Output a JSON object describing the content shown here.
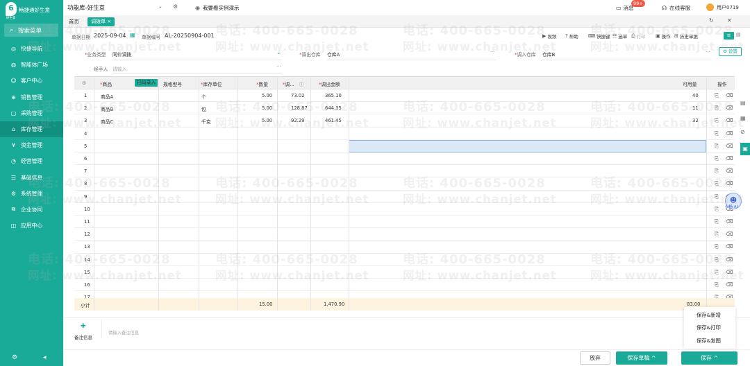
{
  "sidebar": {
    "logo_text": "畅捷通好生意",
    "logo_sub": "好生意",
    "search_label": "搜索菜单",
    "items": [
      {
        "label": "快捷导航",
        "icon": "compass-icon"
      },
      {
        "label": "智能体广场",
        "icon": "robot-icon"
      },
      {
        "label": "客户中心",
        "icon": "user-icon"
      },
      {
        "label": "销售管理",
        "icon": "cart-icon"
      },
      {
        "label": "采购管理",
        "icon": "bag-icon"
      },
      {
        "label": "库存管理",
        "icon": "warehouse-icon"
      },
      {
        "label": "资金管理",
        "icon": "money-icon"
      },
      {
        "label": "经营管理",
        "icon": "chart-icon"
      },
      {
        "label": "基础信息",
        "icon": "database-icon"
      },
      {
        "label": "系统管理",
        "icon": "gear-icon"
      },
      {
        "label": "企业协同",
        "icon": "link-icon"
      },
      {
        "label": "应用中心",
        "icon": "apps-icon"
      }
    ],
    "active": 5
  },
  "topbar": {
    "app_title": "功能库-好生意",
    "demo_link": "我要看实例演示",
    "messages": "消息",
    "badge": "99+",
    "service": "在线客服",
    "user": "用户0719"
  },
  "tabs": {
    "home": "首页",
    "active": "调拨单 ×"
  },
  "form": {
    "date_label": "单据日期",
    "date_value": "2025-09-04",
    "number_label": "单据编号",
    "number_value": "AL-20250904-001",
    "toolbar": [
      "视频",
      "帮助",
      "快捷键",
      "选单",
      "打印",
      "操作",
      "历史单据"
    ]
  },
  "fields": {
    "biz_type_label": "业务类型",
    "biz_type_value": "同价调拨",
    "out_wh_label": "调出仓库",
    "out_wh_value": "仓库A",
    "in_wh_label": "调入仓库",
    "in_wh_value": "仓库B",
    "handler_label": "经手人",
    "handler_placeholder": "请输入",
    "settings": "设置"
  },
  "table": {
    "headers": {
      "product": "商品",
      "scan": "扫码录入",
      "spec": "规格型号",
      "unit": "库存单位",
      "qty": "数量",
      "price": "调...",
      "amount": "调出金额",
      "available": "可用量",
      "ops": "操作"
    },
    "rows": [
      {
        "no": "1",
        "product": "商品A",
        "unit": "个",
        "qty": "5.00",
        "price": "73.02",
        "amount": "365.10",
        "available": "40"
      },
      {
        "no": "2",
        "product": "商品B",
        "unit": "包",
        "qty": "5.00",
        "price": "128.87",
        "amount": "644.35",
        "available": "11"
      },
      {
        "no": "3",
        "product": "商品C",
        "unit": "千克",
        "qty": "5.00",
        "price": "92.29",
        "amount": "461.45",
        "available": "32"
      },
      {
        "no": "4"
      },
      {
        "no": "5"
      },
      {
        "no": "6"
      },
      {
        "no": "7"
      },
      {
        "no": "8"
      },
      {
        "no": "9"
      },
      {
        "no": "10"
      },
      {
        "no": "11"
      },
      {
        "no": "12"
      },
      {
        "no": "13"
      },
      {
        "no": "14"
      },
      {
        "no": "15"
      },
      {
        "no": "16"
      },
      {
        "no": "17"
      }
    ],
    "subtotal": {
      "label": "小计",
      "qty": "15.00",
      "amount": "1,470.90",
      "available": "83.00"
    }
  },
  "note": {
    "label": "备注信息",
    "placeholder": "请输入备注信息"
  },
  "popup": {
    "items": [
      "保存&新增",
      "保存&打印",
      "保存&发图"
    ]
  },
  "footer": {
    "discard": "放弃",
    "save_draft": "保存草稿 ^",
    "save": "保存 ^"
  },
  "robot": {
    "label": "小畅 AI"
  },
  "watermark": {
    "phone": "电话: 400-665-0028",
    "url": "网址: www.chanjet.net"
  }
}
